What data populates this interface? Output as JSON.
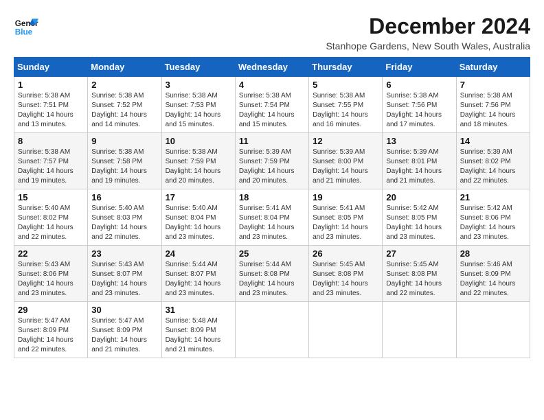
{
  "logo": {
    "line1": "General",
    "line2": "Blue"
  },
  "title": "December 2024",
  "location": "Stanhope Gardens, New South Wales, Australia",
  "days_of_week": [
    "Sunday",
    "Monday",
    "Tuesday",
    "Wednesday",
    "Thursday",
    "Friday",
    "Saturday"
  ],
  "weeks": [
    [
      {
        "day": "1",
        "info": "Sunrise: 5:38 AM\nSunset: 7:51 PM\nDaylight: 14 hours\nand 13 minutes."
      },
      {
        "day": "2",
        "info": "Sunrise: 5:38 AM\nSunset: 7:52 PM\nDaylight: 14 hours\nand 14 minutes."
      },
      {
        "day": "3",
        "info": "Sunrise: 5:38 AM\nSunset: 7:53 PM\nDaylight: 14 hours\nand 15 minutes."
      },
      {
        "day": "4",
        "info": "Sunrise: 5:38 AM\nSunset: 7:54 PM\nDaylight: 14 hours\nand 15 minutes."
      },
      {
        "day": "5",
        "info": "Sunrise: 5:38 AM\nSunset: 7:55 PM\nDaylight: 14 hours\nand 16 minutes."
      },
      {
        "day": "6",
        "info": "Sunrise: 5:38 AM\nSunset: 7:56 PM\nDaylight: 14 hours\nand 17 minutes."
      },
      {
        "day": "7",
        "info": "Sunrise: 5:38 AM\nSunset: 7:56 PM\nDaylight: 14 hours\nand 18 minutes."
      }
    ],
    [
      {
        "day": "8",
        "info": "Sunrise: 5:38 AM\nSunset: 7:57 PM\nDaylight: 14 hours\nand 19 minutes."
      },
      {
        "day": "9",
        "info": "Sunrise: 5:38 AM\nSunset: 7:58 PM\nDaylight: 14 hours\nand 19 minutes."
      },
      {
        "day": "10",
        "info": "Sunrise: 5:38 AM\nSunset: 7:59 PM\nDaylight: 14 hours\nand 20 minutes."
      },
      {
        "day": "11",
        "info": "Sunrise: 5:39 AM\nSunset: 7:59 PM\nDaylight: 14 hours\nand 20 minutes."
      },
      {
        "day": "12",
        "info": "Sunrise: 5:39 AM\nSunset: 8:00 PM\nDaylight: 14 hours\nand 21 minutes."
      },
      {
        "day": "13",
        "info": "Sunrise: 5:39 AM\nSunset: 8:01 PM\nDaylight: 14 hours\nand 21 minutes."
      },
      {
        "day": "14",
        "info": "Sunrise: 5:39 AM\nSunset: 8:02 PM\nDaylight: 14 hours\nand 22 minutes."
      }
    ],
    [
      {
        "day": "15",
        "info": "Sunrise: 5:40 AM\nSunset: 8:02 PM\nDaylight: 14 hours\nand 22 minutes."
      },
      {
        "day": "16",
        "info": "Sunrise: 5:40 AM\nSunset: 8:03 PM\nDaylight: 14 hours\nand 22 minutes."
      },
      {
        "day": "17",
        "info": "Sunrise: 5:40 AM\nSunset: 8:04 PM\nDaylight: 14 hours\nand 23 minutes."
      },
      {
        "day": "18",
        "info": "Sunrise: 5:41 AM\nSunset: 8:04 PM\nDaylight: 14 hours\nand 23 minutes."
      },
      {
        "day": "19",
        "info": "Sunrise: 5:41 AM\nSunset: 8:05 PM\nDaylight: 14 hours\nand 23 minutes."
      },
      {
        "day": "20",
        "info": "Sunrise: 5:42 AM\nSunset: 8:05 PM\nDaylight: 14 hours\nand 23 minutes."
      },
      {
        "day": "21",
        "info": "Sunrise: 5:42 AM\nSunset: 8:06 PM\nDaylight: 14 hours\nand 23 minutes."
      }
    ],
    [
      {
        "day": "22",
        "info": "Sunrise: 5:43 AM\nSunset: 8:06 PM\nDaylight: 14 hours\nand 23 minutes."
      },
      {
        "day": "23",
        "info": "Sunrise: 5:43 AM\nSunset: 8:07 PM\nDaylight: 14 hours\nand 23 minutes."
      },
      {
        "day": "24",
        "info": "Sunrise: 5:44 AM\nSunset: 8:07 PM\nDaylight: 14 hours\nand 23 minutes."
      },
      {
        "day": "25",
        "info": "Sunrise: 5:44 AM\nSunset: 8:08 PM\nDaylight: 14 hours\nand 23 minutes."
      },
      {
        "day": "26",
        "info": "Sunrise: 5:45 AM\nSunset: 8:08 PM\nDaylight: 14 hours\nand 23 minutes."
      },
      {
        "day": "27",
        "info": "Sunrise: 5:45 AM\nSunset: 8:08 PM\nDaylight: 14 hours\nand 22 minutes."
      },
      {
        "day": "28",
        "info": "Sunrise: 5:46 AM\nSunset: 8:09 PM\nDaylight: 14 hours\nand 22 minutes."
      }
    ],
    [
      {
        "day": "29",
        "info": "Sunrise: 5:47 AM\nSunset: 8:09 PM\nDaylight: 14 hours\nand 22 minutes."
      },
      {
        "day": "30",
        "info": "Sunrise: 5:47 AM\nSunset: 8:09 PM\nDaylight: 14 hours\nand 21 minutes."
      },
      {
        "day": "31",
        "info": "Sunrise: 5:48 AM\nSunset: 8:09 PM\nDaylight: 14 hours\nand 21 minutes."
      },
      null,
      null,
      null,
      null
    ]
  ]
}
